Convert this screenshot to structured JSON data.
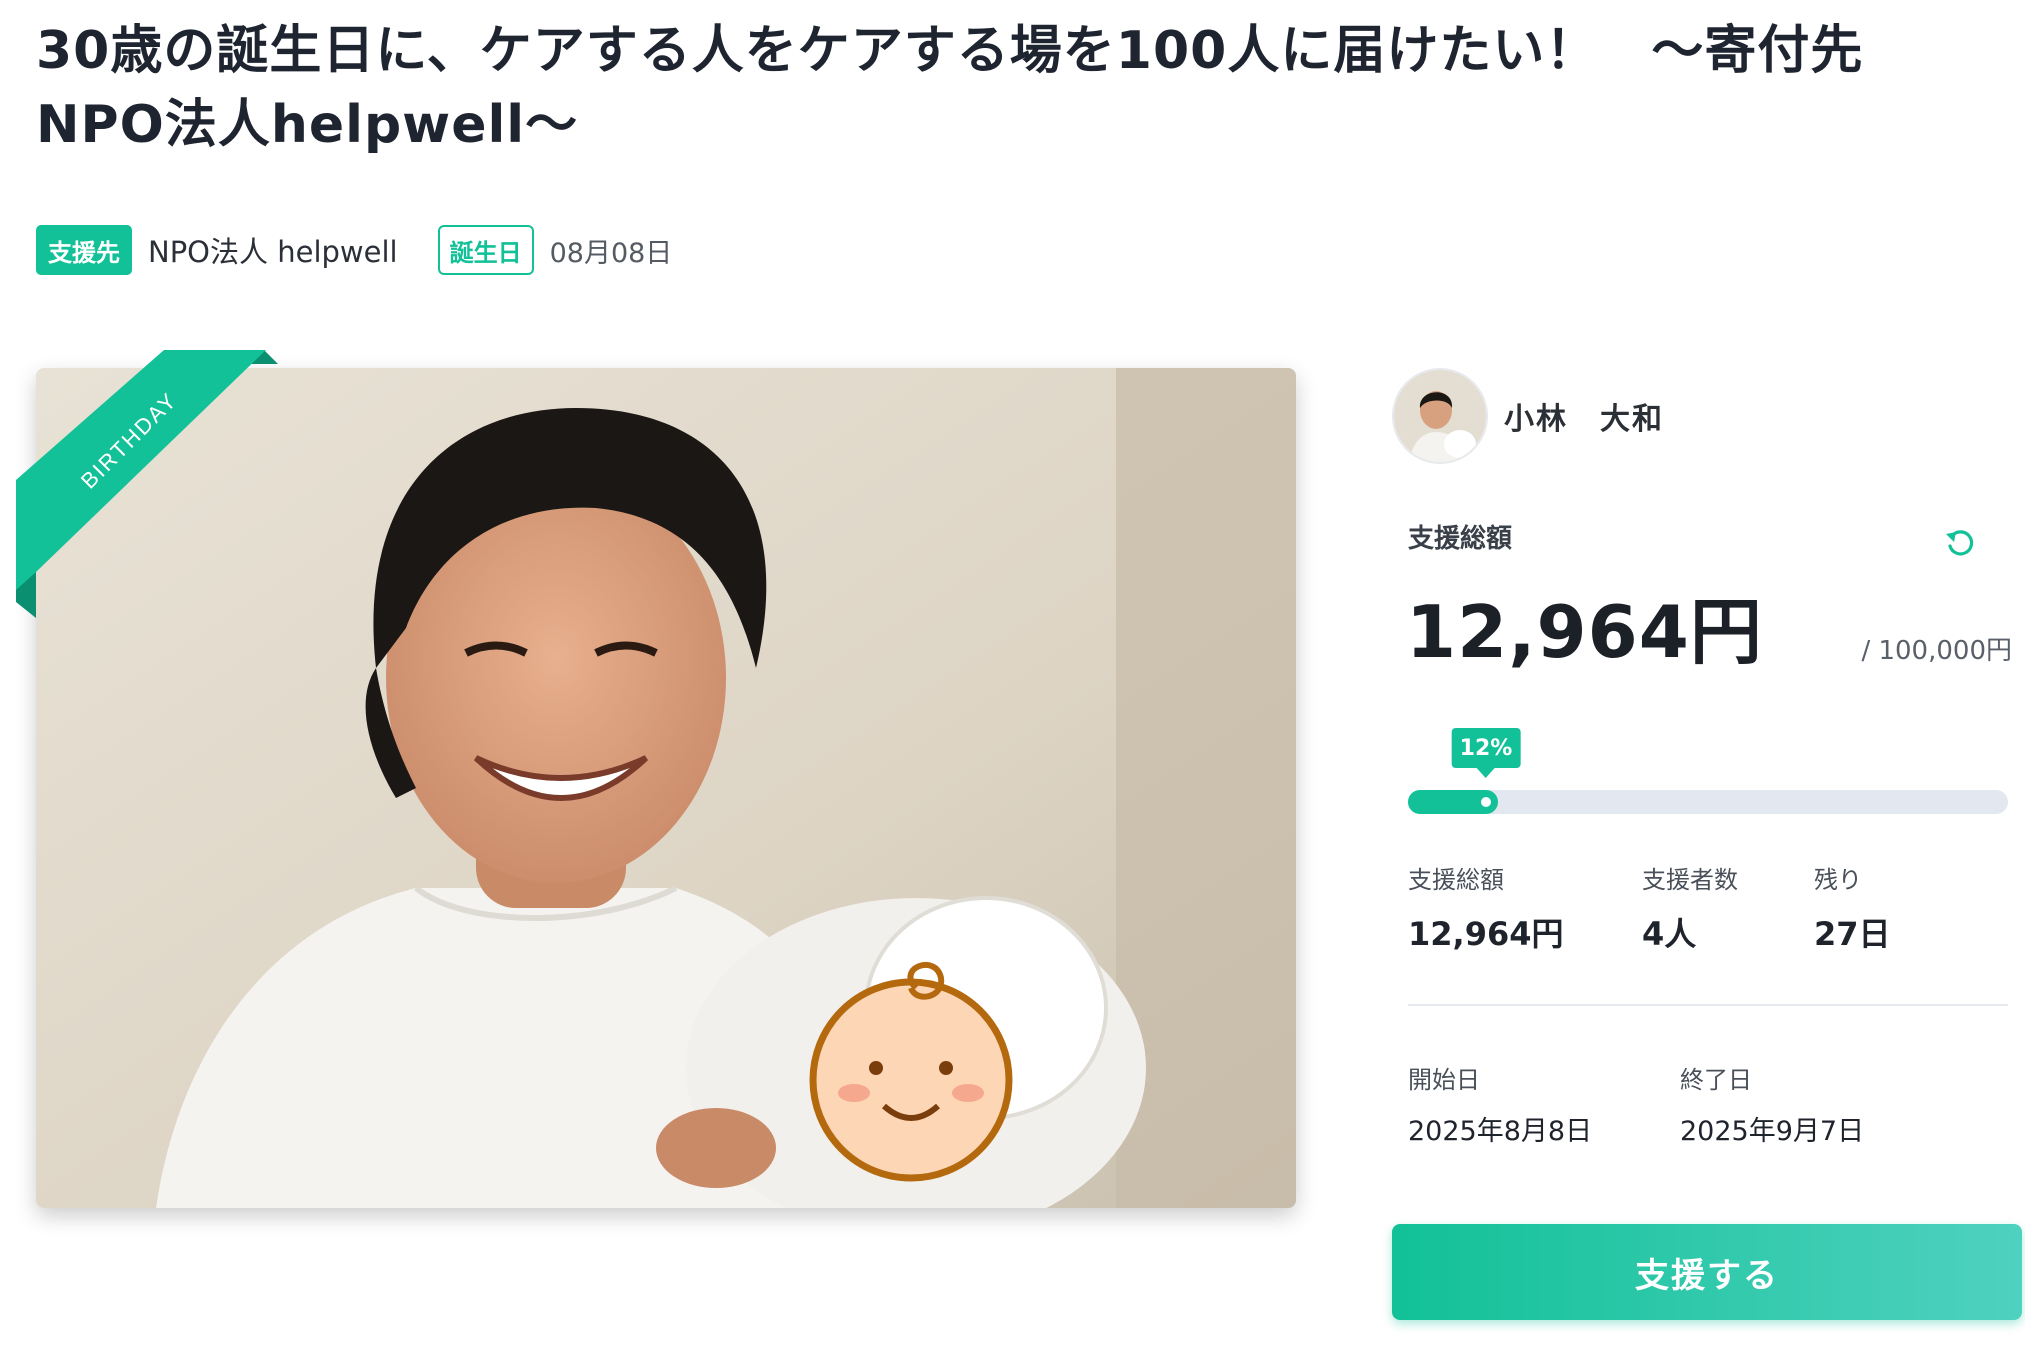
{
  "project": {
    "title": "30歳の誕生日に、ケアする人をケアする場を100人に届けたい！　〜寄付先　NPO法人helpwell〜",
    "beneficiary_badge": "支援先",
    "beneficiary_name": "NPO法人 helpwell",
    "birthday_badge": "誕生日",
    "birthday_date": "08月08日",
    "ribbon_text": "BIRTHDAY"
  },
  "organizer": {
    "name": "小林　大和"
  },
  "funding": {
    "total_label": "支援総額",
    "total_amount": "12,964円",
    "goal": "/ 100,000円",
    "percent_label": "12%",
    "progress_fraction": 0.1296
  },
  "stats": {
    "amount_label": "支援総額",
    "amount_value": "12,964円",
    "supporters_label": "支援者数",
    "supporters_value": "4人",
    "remaining_label": "残り",
    "remaining_value": "27日"
  },
  "dates": {
    "start_label": "開始日",
    "start_value": "2025年8月8日",
    "end_label": "終了日",
    "end_value": "2025年9月7日"
  },
  "cta": {
    "support_label": "支援する"
  },
  "colors": {
    "accent": "#12c197",
    "track": "#e3e7ef"
  },
  "icons": {
    "refresh": "refresh-icon"
  }
}
